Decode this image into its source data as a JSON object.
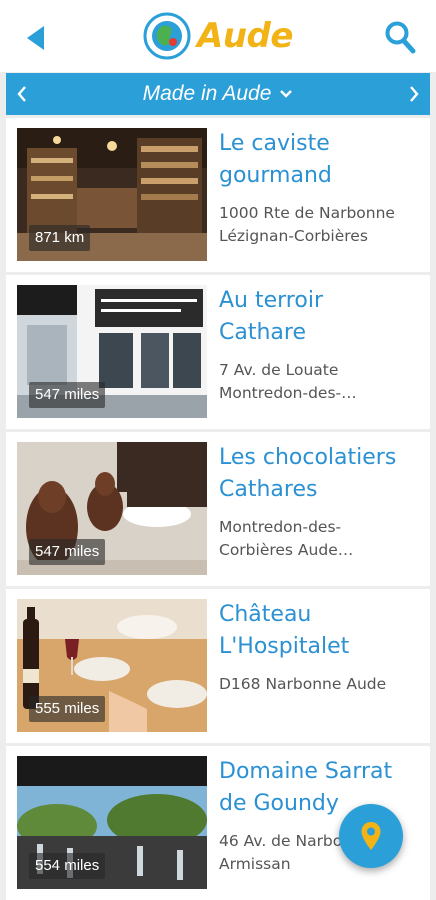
{
  "header": {
    "title": "Aude",
    "back_icon": "back-arrow-icon",
    "search_icon": "search-icon",
    "logo_icon": "globe-logo-icon"
  },
  "category": {
    "label": "Made in Aude",
    "dropdown_icon": "chevron-down-icon",
    "prev_icon": "chevron-left-icon",
    "next_icon": "chevron-right-icon"
  },
  "colors": {
    "accent": "#2b9fd8",
    "title_blue": "#2b91d3",
    "brand_yellow": "#f2b316",
    "pin_yellow": "#f2b316"
  },
  "places": [
    {
      "title_line1": "Le caviste",
      "title_line2": "gourmand",
      "addr_line1": "1000 Rte de Narbonne",
      "addr_line2": "Lézignan-Corbières",
      "distance": "871 km"
    },
    {
      "title_line1": "Au terroir",
      "title_line2": "Cathare",
      "addr_line1": "7 Av. de Louate",
      "addr_line2": "Montredon-des-…",
      "distance": "547 miles"
    },
    {
      "title_line1": "Les chocolatiers",
      "title_line2": "Cathares",
      "addr_line1": "Montredon-des-",
      "addr_line2": "Corbières Aude…",
      "distance": "547 miles"
    },
    {
      "title_line1": "Château",
      "title_line2": "L'Hospitalet",
      "addr_line1": "D168 Narbonne Aude",
      "addr_line2": "",
      "distance": "555 miles"
    },
    {
      "title_line1": "Domaine Sarrat",
      "title_line2": "de Goundy",
      "addr_line1": "46 Av. de Narbo",
      "addr_line2": "Armissan",
      "distance": "554 miles"
    }
  ],
  "fab": {
    "icon": "map-pin-icon"
  }
}
